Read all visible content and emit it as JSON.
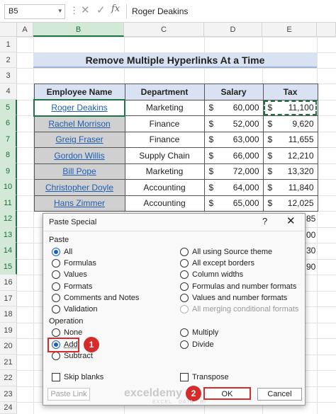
{
  "formula_bar": {
    "name_box": "B5",
    "formula_value": "Roger Deakins"
  },
  "columns": [
    "A",
    "B",
    "C",
    "D",
    "E"
  ],
  "rows": [
    "1",
    "2",
    "3",
    "4",
    "5",
    "6",
    "7",
    "8",
    "9",
    "10",
    "11",
    "12",
    "13",
    "14",
    "15",
    "16",
    "17",
    "18",
    "19",
    "20",
    "21",
    "22",
    "23",
    "24"
  ],
  "sheet_title": "Remove Multiple Hyperlinks At a Time",
  "table": {
    "headers": [
      "Employee Name",
      "Department",
      "Salary",
      "Tax"
    ],
    "currency": "$",
    "rows": [
      {
        "name": "Roger Deakins",
        "dept": "Marketing",
        "salary": "60,000",
        "tax": "11,100"
      },
      {
        "name": "Rachel Morrison",
        "dept": "Finance",
        "salary": "52,000",
        "tax": "9,620"
      },
      {
        "name": "Greig Fraser",
        "dept": "Finance",
        "salary": "63,000",
        "tax": "11,655"
      },
      {
        "name": "Gordon Willis",
        "dept": "Supply Chain",
        "salary": "66,000",
        "tax": "12,210"
      },
      {
        "name": "Bill Pope",
        "dept": "Marketing",
        "salary": "72,000",
        "tax": "13,320"
      },
      {
        "name": "Christopher Doyle",
        "dept": "Accounting",
        "salary": "64,000",
        "tax": "11,840"
      },
      {
        "name": "Hans Zimmer",
        "dept": "Accounting",
        "salary": "65,000",
        "tax": "12,025"
      }
    ],
    "hidden_tax_fragments": [
      "00",
      "30",
      "85",
      "90"
    ]
  },
  "dialog": {
    "title": "Paste Special",
    "help": "?",
    "close": "✕",
    "paste_label": "Paste",
    "paste_left": [
      "All",
      "Formulas",
      "Values",
      "Formats",
      "Comments and Notes",
      "Validation"
    ],
    "paste_right": [
      "All using Source theme",
      "All except borders",
      "Column widths",
      "Formulas and number formats",
      "Values and number formats",
      "All merging conditional formats"
    ],
    "operation_label": "Operation",
    "operation_left": [
      "None",
      "Add",
      "Subtract"
    ],
    "operation_right": [
      "Multiply",
      "Divide"
    ],
    "skip_blanks": "Skip blanks",
    "transpose": "Transpose",
    "paste_link": "Paste Link",
    "ok": "OK",
    "cancel": "Cancel",
    "badge_1": "1",
    "badge_2": "2"
  },
  "watermark": {
    "brand": "exceldemy",
    "sub": "EXCEL · DATA · BI"
  },
  "colors": {
    "accent_red": "#d62b2b",
    "excel_green": "#217346",
    "header_blue": "#d9e2f2",
    "radio_blue": "#1a5fc8",
    "link_blue": "#1f5fb3"
  }
}
